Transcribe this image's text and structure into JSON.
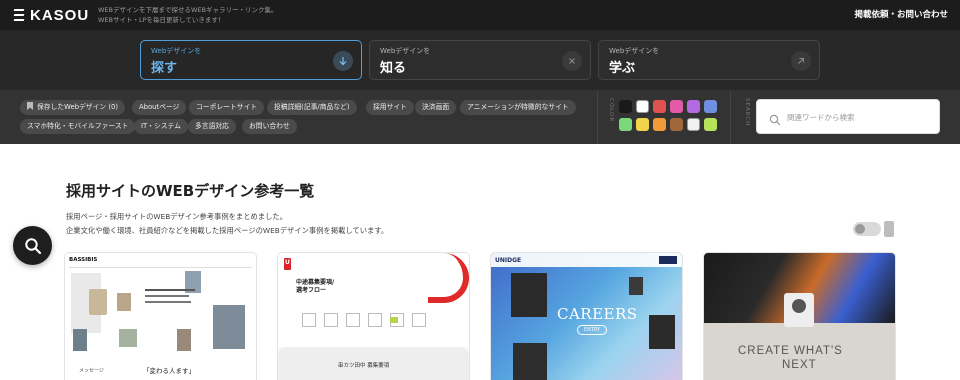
{
  "header": {
    "logo_text": "KASOU",
    "tagline_line1": "WEBデザインを下層まで探せるWEBギャラリー・リンク集。",
    "tagline_line2": "WEBサイト・LPを毎日更新していきます！",
    "contact_label": "掲載依頼・お問い合わせ"
  },
  "hero": {
    "cards": [
      {
        "sub": "Webデザインを",
        "main": "探す",
        "icon": "arrow-down-icon",
        "active": true
      },
      {
        "sub": "Webデザインを",
        "main": "知る",
        "icon": "close-circle-icon",
        "active": false
      },
      {
        "sub": "Webデザインを",
        "main": "学ぶ",
        "icon": "arrow-up-right-icon",
        "active": false
      }
    ]
  },
  "filters": {
    "tags": [
      "保存したWebデザイン (0)",
      "Aboutページ",
      "コーポレートサイト",
      "投稿詳細(記事/商品など)",
      "採用サイト",
      "決済画面",
      "アニメーションが特徴的なサイト",
      "スマホ特化・モバイルファースト",
      "IT・システム",
      "多言語対応",
      "お問い合わせ"
    ],
    "color_label": "COLOR",
    "search_label": "SEARCH",
    "swatches": [
      "#1a1a1a",
      "#ffffff",
      "#e05252",
      "#e25aa8",
      "#b46ae0",
      "#6f8fe0",
      "#7cd67c",
      "#f2d34a",
      "#f29a3a",
      "#a0673a",
      "#f0f0f0",
      "#b5e35a"
    ],
    "search_placeholder": "関連ワードから検索"
  },
  "main": {
    "title": "採用サイトのWEBデザイン参考一覧",
    "desc_line1": "採用ページ・採用サイトのWEBデザイン参考事例をまとめました。",
    "desc_line2": "企業文化や働く環境、社員紹介などを掲載した採用ページのWEBデザイン事例を掲載しています。"
  },
  "thumbnails": [
    {
      "brand": "BASSIBIS",
      "caption": "「変わる人ます」",
      "sub": "メッセージ"
    },
    {
      "brand": "U",
      "caption": "中途募集要項/\n選考フロー",
      "sub": "串カツ田中 募集要項"
    },
    {
      "brand": "UNIDGE",
      "caption": "CAREERS",
      "sub": "ENTRY"
    },
    {
      "brand": "",
      "caption": "CREATE WHAT'S",
      "caption2": "NEXT",
      "sub": ""
    }
  ]
}
